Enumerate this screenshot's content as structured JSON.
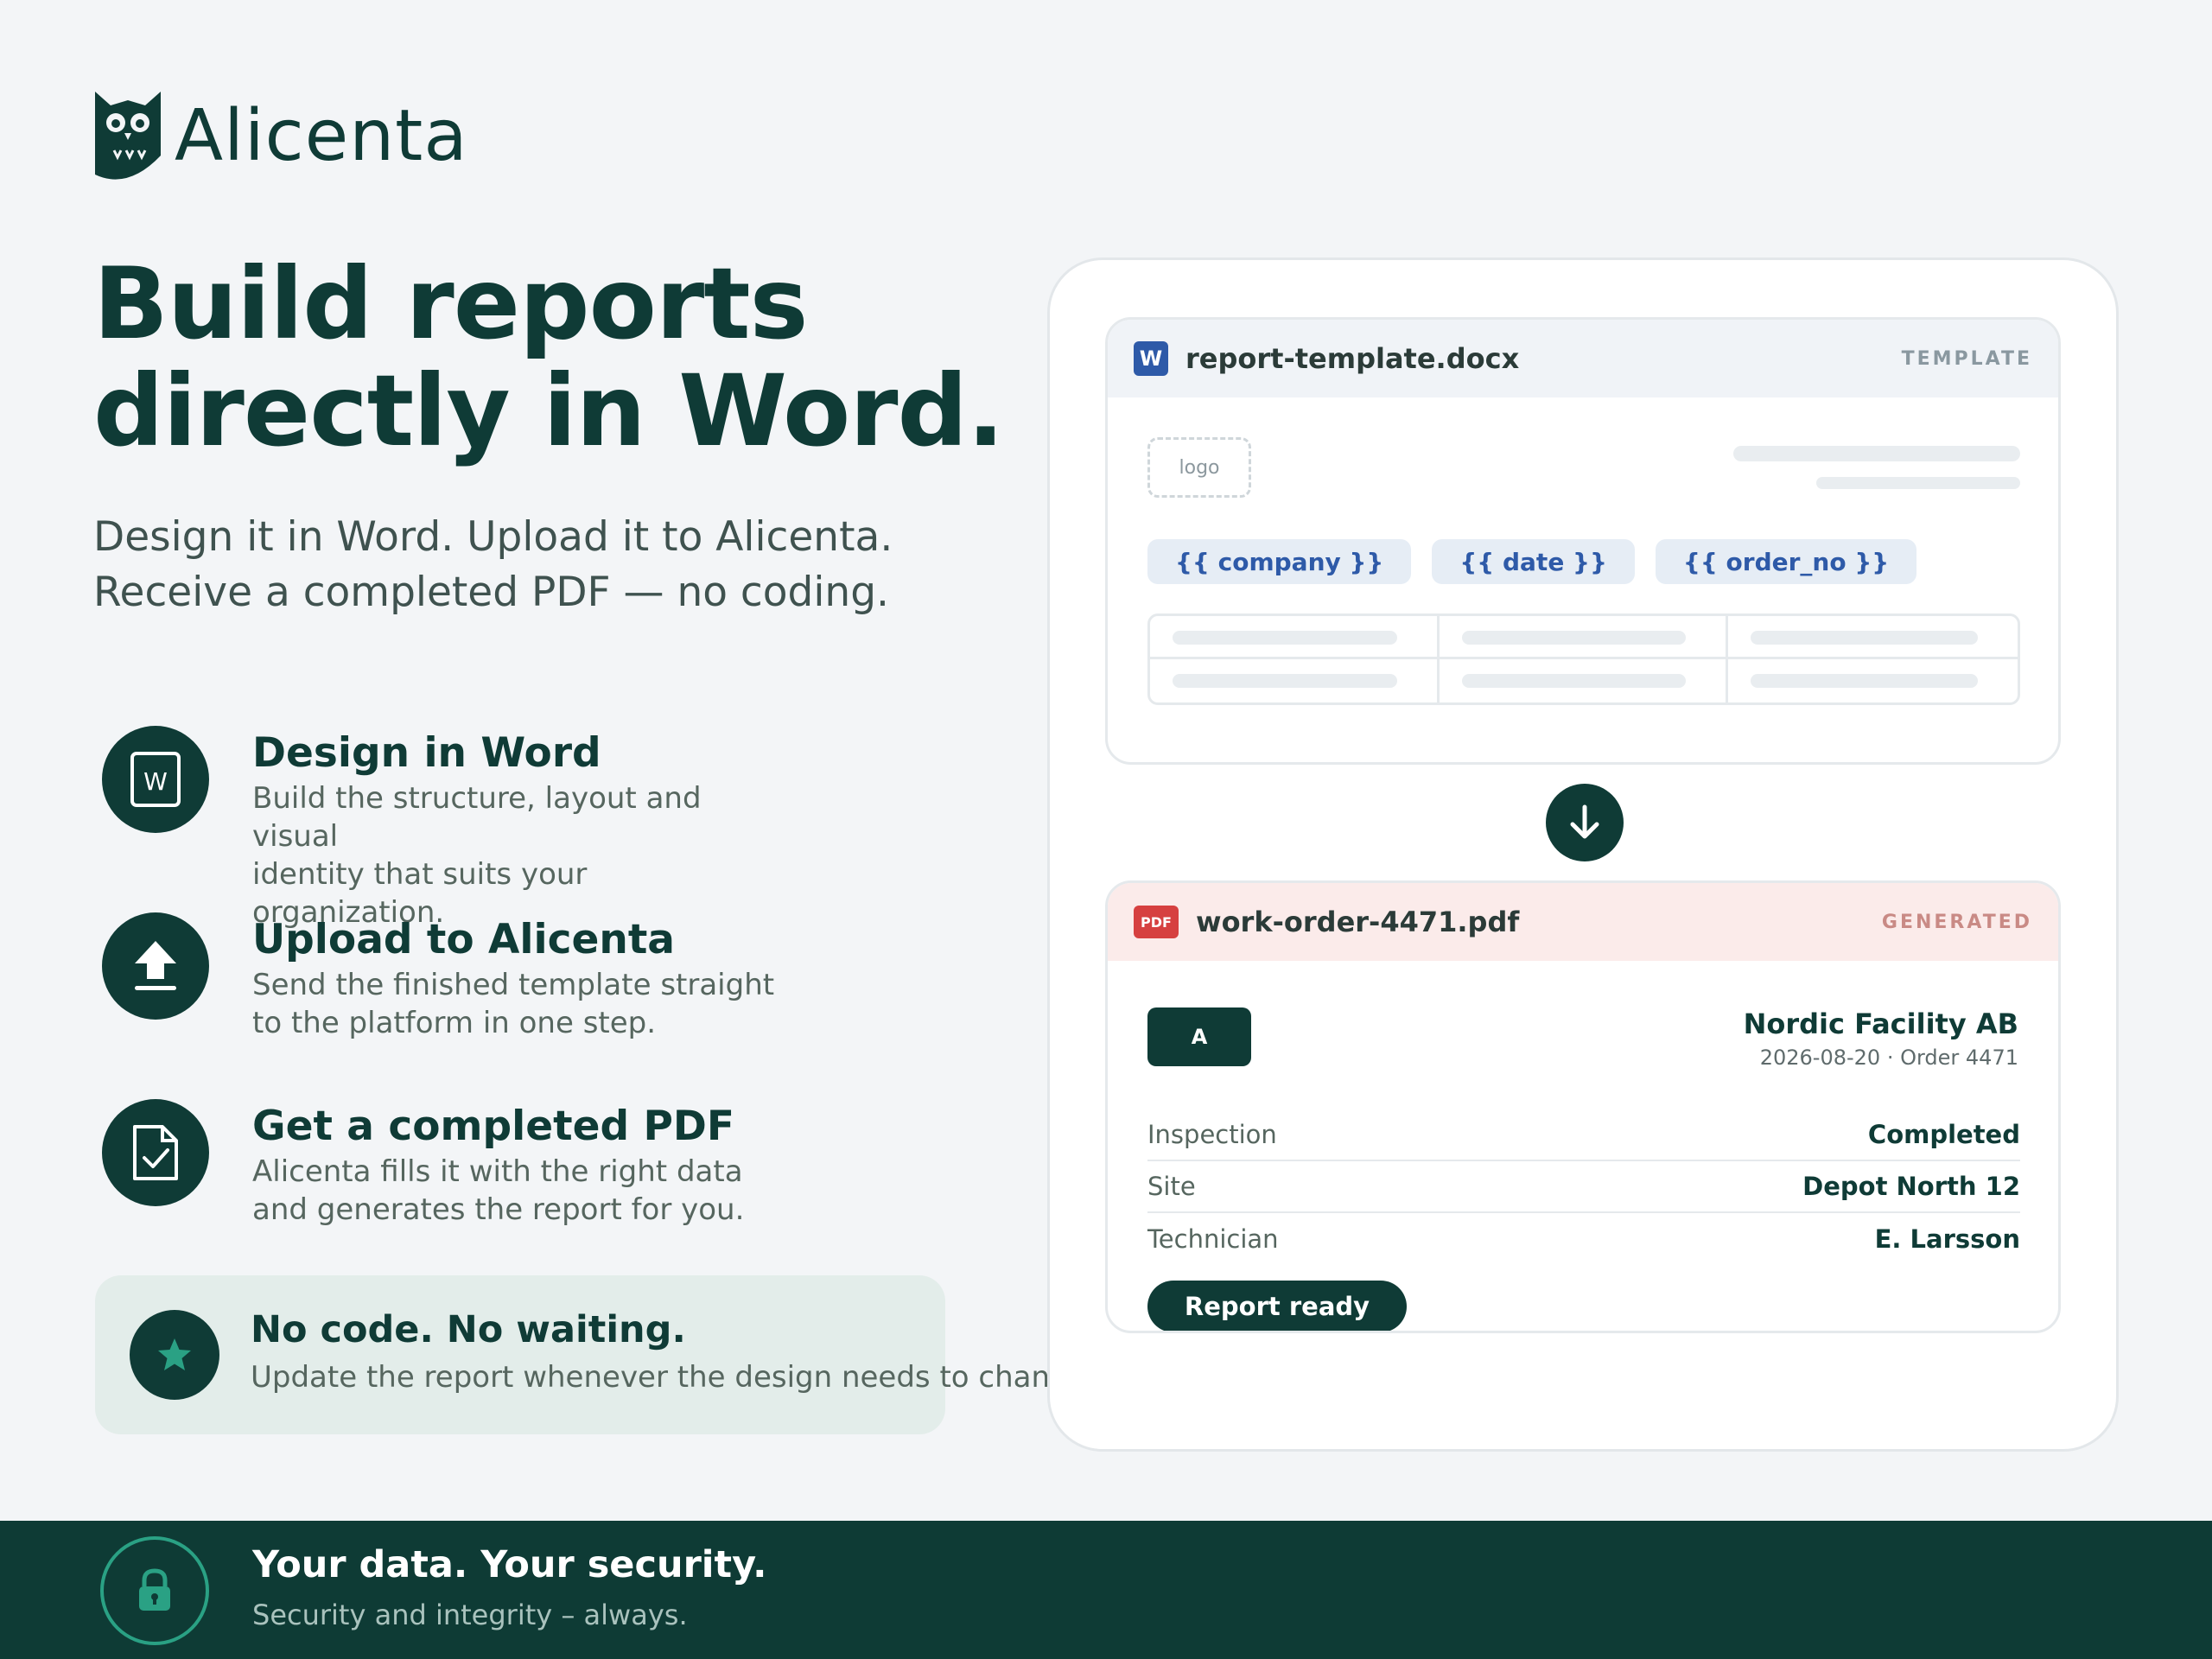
{
  "brand": {
    "name": "Alicenta"
  },
  "hero": {
    "headline_lines": [
      "Build reports",
      "directly in Word."
    ],
    "subtitle_lines": [
      "Design it in Word. Upload it to Alicenta.",
      "Receive a completed PDF — no coding."
    ]
  },
  "features": [
    {
      "icon": "word-document-icon",
      "title": "Design in Word",
      "desc_lines": [
        "Build the structure, layout and visual",
        "identity that suits your organization."
      ]
    },
    {
      "icon": "upload-icon",
      "title": "Upload to Alicenta",
      "desc_lines": [
        "Send the finished template straight",
        "to the platform in one step."
      ]
    },
    {
      "icon": "document-check-icon",
      "title": "Get a completed PDF",
      "desc_lines": [
        "Alicenta fills it with the right data",
        "and generates the report for you."
      ]
    }
  ],
  "callout": {
    "icon": "star-icon",
    "title": "No code. No waiting.",
    "desc": "Update the report whenever the design needs to change."
  },
  "template_card": {
    "badge": "W",
    "file_name": "report-template.docx",
    "tag": "TEMPLATE",
    "logo_placeholder": "logo",
    "fields": [
      "{{ company }}",
      "{{ date }}",
      "{{ order_no }}"
    ]
  },
  "generated_card": {
    "badge": "PDF",
    "file_name": "work-order-4471.pdf",
    "tag": "GENERATED",
    "avatar": "A",
    "company": "Nordic Facility AB",
    "meta": "2026-08-20 · Order 4471",
    "rows": [
      {
        "label": "Inspection",
        "value": "Completed"
      },
      {
        "label": "Site",
        "value": "Depot North 12"
      },
      {
        "label": "Technician",
        "value": "E. Larsson"
      }
    ],
    "status_button": "Report ready"
  },
  "footer": {
    "icon": "lock-icon",
    "title": "Your data. Your security.",
    "desc": "Security and integrity – always."
  },
  "colors": {
    "primary": "#0f3b36",
    "accent": "#2aa184",
    "word_blue": "#2e5aa8",
    "pdf_red": "#d64040"
  }
}
